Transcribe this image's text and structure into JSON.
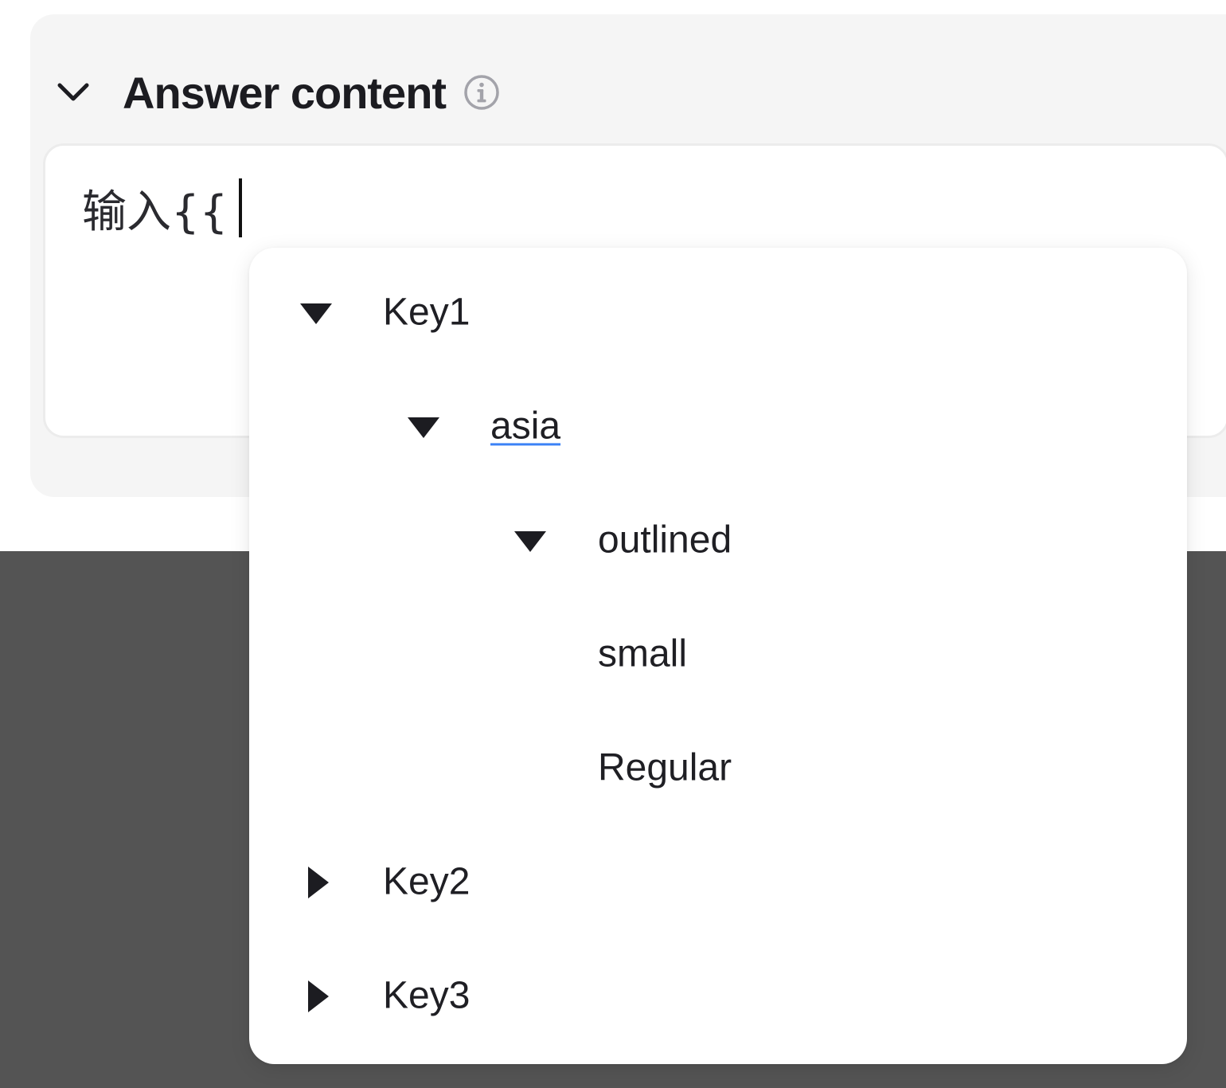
{
  "section": {
    "title": "Answer content",
    "collapse_icon": "chevron-down-icon",
    "info_icon": "info-circle-icon"
  },
  "editor": {
    "value": "输入{{"
  },
  "tree": {
    "items": [
      {
        "label": "Key1",
        "expanded": true,
        "level": 0,
        "icon": "caret-down-icon"
      },
      {
        "label": "asia",
        "expanded": true,
        "level": 1,
        "icon": "caret-down-icon"
      },
      {
        "label": "outlined",
        "expanded": true,
        "level": 2,
        "icon": "caret-down-icon"
      },
      {
        "label": "small",
        "level": 3
      },
      {
        "label": "Regular",
        "level": 3
      },
      {
        "label": "Key2",
        "expanded": false,
        "level": 0,
        "icon": "caret-right-icon"
      },
      {
        "label": "Key3",
        "expanded": false,
        "level": 0,
        "icon": "caret-right-icon"
      }
    ]
  },
  "colors": {
    "panel_bg": "#f5f5f5",
    "backdrop": "#545454",
    "text": "#1f1f24",
    "spellcheck_underline": "#3b82f6"
  }
}
